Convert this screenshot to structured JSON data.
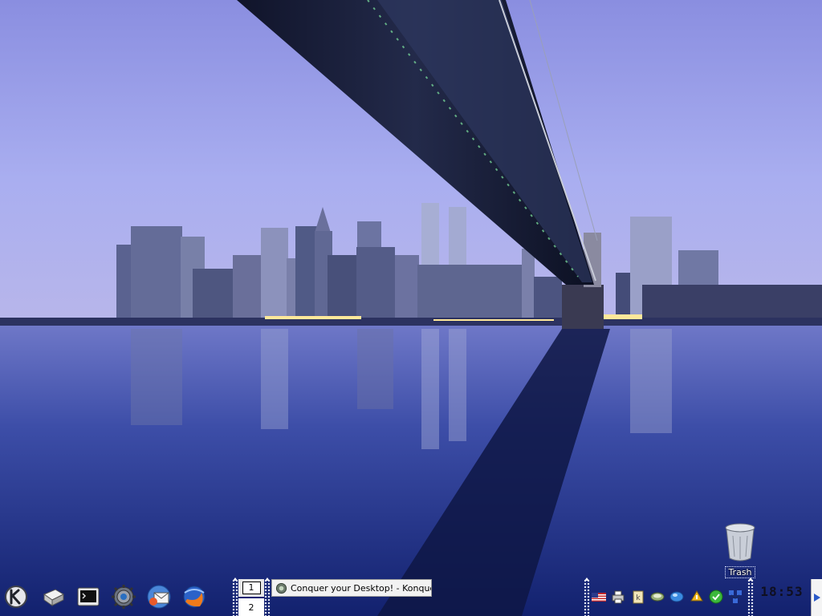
{
  "desktop": {
    "icons": [
      {
        "label": "Trash",
        "icon": "trash-icon"
      }
    ]
  },
  "panel": {
    "launchers": [
      {
        "icon": "kde-menu-icon"
      },
      {
        "icon": "home-folder-icon"
      },
      {
        "icon": "terminal-icon"
      },
      {
        "icon": "control-center-icon"
      },
      {
        "icon": "mail-client-icon"
      },
      {
        "icon": "web-browser-icon"
      }
    ],
    "pager": {
      "desktops": [
        "1",
        "2"
      ],
      "current": "1"
    },
    "taskbar": {
      "items": [
        {
          "title": "Conquer your Desktop! - Konque",
          "icon": "konqueror-icon"
        }
      ]
    },
    "systray": [
      {
        "icon": "keyboard-layout-us-icon"
      },
      {
        "icon": "printer-icon"
      },
      {
        "icon": "klipper-icon"
      },
      {
        "icon": "kmix-icon"
      },
      {
        "icon": "network-icon"
      },
      {
        "icon": "kwallet-icon"
      },
      {
        "icon": "update-ok-icon"
      },
      {
        "icon": "network-manager-icon"
      }
    ],
    "clock": {
      "time": "18:53"
    }
  },
  "colors": {
    "sky_top": "#8d8fe0",
    "sky_horizon": "#b4b8f0",
    "water": "#1d2f86",
    "bridge": "#141a2e"
  }
}
